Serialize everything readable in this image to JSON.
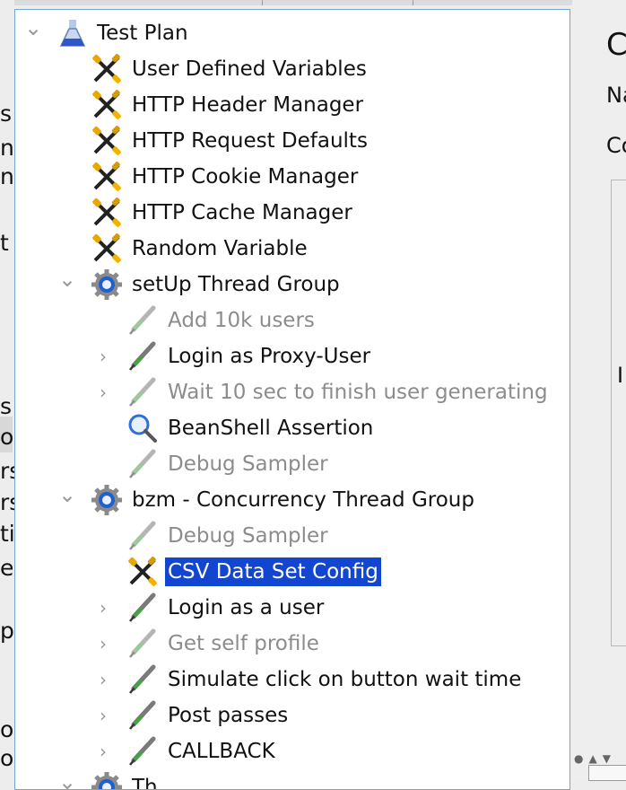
{
  "tree": {
    "items": [
      {
        "label": "Test Plan",
        "depth": 0,
        "icon": "test-plan-flask-icon",
        "toggle": "expanded",
        "state": "normal"
      },
      {
        "label": "User Defined Variables",
        "depth": 1,
        "icon": "config-element-scissors-icon",
        "toggle": "none",
        "state": "normal"
      },
      {
        "label": "HTTP Header Manager",
        "depth": 1,
        "icon": "config-element-scissors-icon",
        "toggle": "none",
        "state": "normal"
      },
      {
        "label": "HTTP Request Defaults",
        "depth": 1,
        "icon": "config-element-scissors-icon",
        "toggle": "none",
        "state": "normal"
      },
      {
        "label": "HTTP Cookie Manager",
        "depth": 1,
        "icon": "config-element-scissors-icon",
        "toggle": "none",
        "state": "normal"
      },
      {
        "label": "HTTP Cache Manager",
        "depth": 1,
        "icon": "config-element-scissors-icon",
        "toggle": "none",
        "state": "normal"
      },
      {
        "label": "Random Variable",
        "depth": 1,
        "icon": "config-element-scissors-icon",
        "toggle": "none",
        "state": "normal"
      },
      {
        "label": "setUp Thread Group",
        "depth": 1,
        "icon": "thread-group-gear-icon",
        "toggle": "expanded",
        "state": "normal"
      },
      {
        "label": "Add 10k users",
        "depth": 2,
        "icon": "sampler-pipette-icon",
        "toggle": "none",
        "state": "disabled"
      },
      {
        "label": "Login as Proxy-User",
        "depth": 2,
        "icon": "sampler-pipette-icon",
        "toggle": "collapsed",
        "state": "normal"
      },
      {
        "label": "Wait 10 sec to finish user generating",
        "depth": 2,
        "icon": "sampler-pipette-icon",
        "toggle": "collapsed",
        "state": "disabled"
      },
      {
        "label": "BeanShell Assertion",
        "depth": 2,
        "icon": "assertion-magnifier-icon",
        "toggle": "none",
        "state": "normal"
      },
      {
        "label": "Debug Sampler",
        "depth": 2,
        "icon": "sampler-pipette-icon",
        "toggle": "none",
        "state": "disabled"
      },
      {
        "label": "bzm - Concurrency Thread Group",
        "depth": 1,
        "icon": "thread-group-gear-icon",
        "toggle": "expanded",
        "state": "normal"
      },
      {
        "label": "Debug Sampler",
        "depth": 2,
        "icon": "sampler-pipette-icon",
        "toggle": "none",
        "state": "disabled"
      },
      {
        "label": "CSV Data Set Config",
        "depth": 2,
        "icon": "config-element-scissors-icon",
        "toggle": "none",
        "state": "selected"
      },
      {
        "label": "Login as a user",
        "depth": 2,
        "icon": "sampler-pipette-icon",
        "toggle": "collapsed",
        "state": "normal"
      },
      {
        "label": "Get self profile",
        "depth": 2,
        "icon": "sampler-pipette-icon",
        "toggle": "collapsed",
        "state": "disabled"
      },
      {
        "label": "Simulate click on button wait time",
        "depth": 2,
        "icon": "sampler-pipette-icon",
        "toggle": "collapsed",
        "state": "normal"
      },
      {
        "label": "Post passes",
        "depth": 2,
        "icon": "sampler-pipette-icon",
        "toggle": "collapsed",
        "state": "normal"
      },
      {
        "label": "CALLBACK",
        "depth": 2,
        "icon": "sampler-pipette-icon",
        "toggle": "collapsed",
        "state": "normal"
      },
      {
        "label": "Th",
        "depth": 1,
        "icon": "thread-group-gear-icon",
        "toggle": "expanded",
        "state": "normal"
      }
    ]
  },
  "left_pane": {
    "fragments": [
      "s",
      "na",
      "na",
      "t",
      "s",
      "o",
      "rs",
      "rs",
      "tio",
      "e",
      "pe",
      "o",
      "o."
    ]
  },
  "right_pane": {
    "title_fragment": "C",
    "name_label_fragment": "Na",
    "comments_label_fragment": "Co",
    "group_fragment": "I"
  },
  "colors": {
    "selection": "#1346d0",
    "tree_border": "#6fa6d6",
    "disabled_text": "#8c8c8c"
  }
}
